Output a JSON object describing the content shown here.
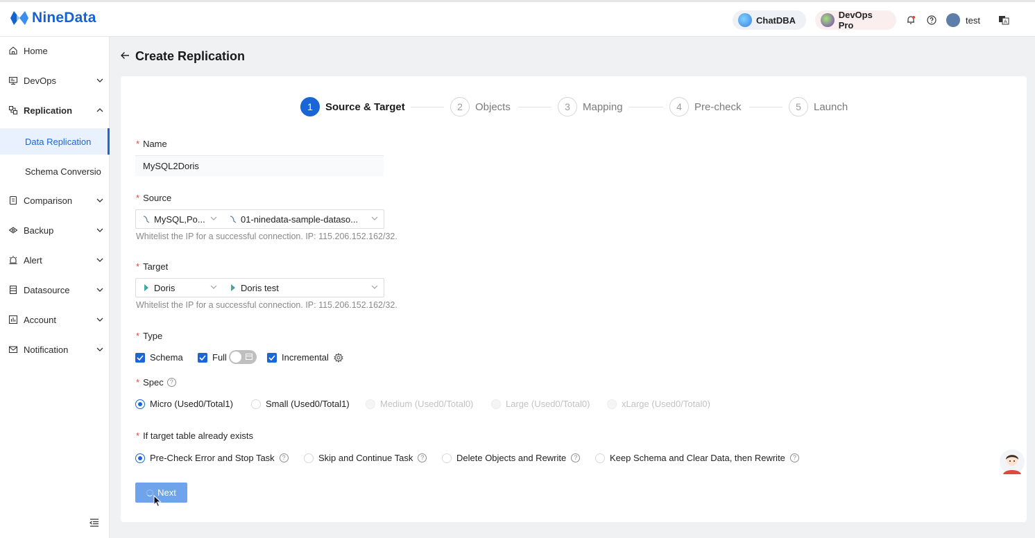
{
  "brand": {
    "name": "NineData",
    "color": "#1463d3"
  },
  "header": {
    "chatdba_label": "ChatDBA",
    "devops_label": "DevOps Pro",
    "user_name": "test",
    "icons": [
      "bell-icon",
      "help-icon",
      "language-icon"
    ]
  },
  "sidebar": {
    "items": [
      {
        "label": "Home",
        "icon": "home-icon"
      },
      {
        "label": "DevOps",
        "icon": "monitor-icon"
      },
      {
        "label": "Replication",
        "icon": "replication-icon",
        "expanded": true
      },
      {
        "label": "Comparison",
        "icon": "comparison-icon"
      },
      {
        "label": "Backup",
        "icon": "backup-icon"
      },
      {
        "label": "Alert",
        "icon": "alert-icon"
      },
      {
        "label": "Datasource",
        "icon": "datasource-icon"
      },
      {
        "label": "Account",
        "icon": "account-icon"
      },
      {
        "label": "Notification",
        "icon": "mail-icon"
      }
    ],
    "sub_items": [
      {
        "label": "Data Replication",
        "active": true
      },
      {
        "label": "Schema Conversio",
        "active": false
      }
    ]
  },
  "page": {
    "title": "Create Replication"
  },
  "steps": [
    {
      "num": "1",
      "label": "Source & Target",
      "active": true
    },
    {
      "num": "2",
      "label": "Objects",
      "active": false
    },
    {
      "num": "3",
      "label": "Mapping",
      "active": false
    },
    {
      "num": "4",
      "label": "Pre-check",
      "active": false
    },
    {
      "num": "5",
      "label": "Launch",
      "active": false
    }
  ],
  "form": {
    "name": {
      "label": "Name",
      "value": "MySQL2Doris"
    },
    "source": {
      "label": "Source",
      "type_value": "MySQL,Po...",
      "datasource_value": "01-ninedata-sample-dataso...",
      "hint": "Whitelist the IP for a successful connection. IP: 115.206.152.162/32."
    },
    "target": {
      "label": "Target",
      "type_value": "Doris",
      "datasource_value": "Doris test",
      "hint": "Whitelist the IP for a successful connection. IP: 115.206.152.162/32."
    },
    "type": {
      "label": "Type",
      "options": [
        {
          "label": "Schema",
          "checked": true
        },
        {
          "label": "Full",
          "checked": true
        },
        {
          "label": "Incremental",
          "checked": true
        }
      ],
      "full_toggle_on": false
    },
    "spec": {
      "label": "Spec",
      "options": [
        {
          "label": "Micro (Used0/Total1)",
          "selected": true,
          "disabled": false
        },
        {
          "label": "Small (Used0/Total1)",
          "selected": false,
          "disabled": false
        },
        {
          "label": "Medium (Used0/Total0)",
          "selected": false,
          "disabled": true
        },
        {
          "label": "Large (Used0/Total0)",
          "selected": false,
          "disabled": true
        },
        {
          "label": "xLarge (Used0/Total0)",
          "selected": false,
          "disabled": true
        }
      ]
    },
    "exists": {
      "label": "If target table already exists",
      "options": [
        {
          "label": "Pre-Check Error and Stop Task",
          "selected": true
        },
        {
          "label": "Skip and Continue Task",
          "selected": false
        },
        {
          "label": "Delete Objects and Rewrite",
          "selected": false
        },
        {
          "label": "Keep Schema and Clear Data, then Rewrite",
          "selected": false
        }
      ]
    },
    "next_label": "Next"
  },
  "colors": {
    "primary": "#1a66d6",
    "required": "#e0483d"
  }
}
